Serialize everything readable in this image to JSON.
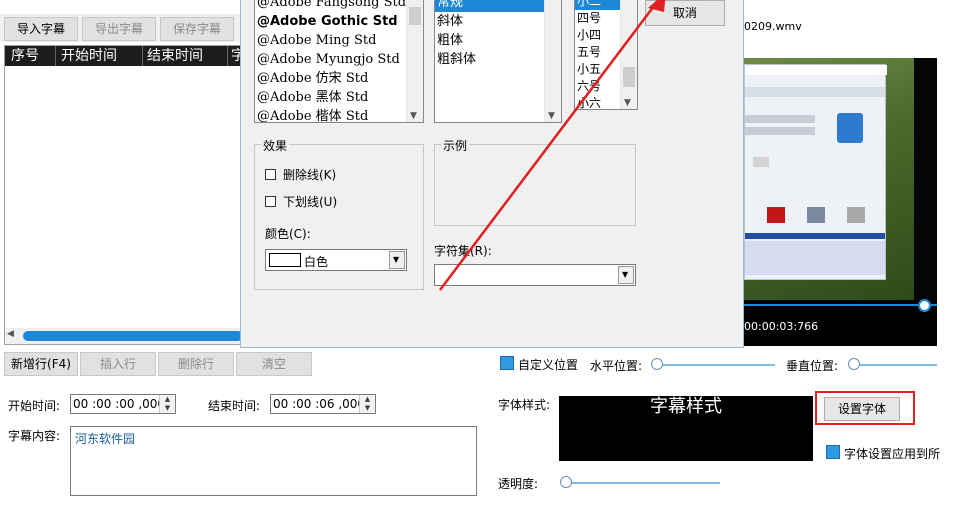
{
  "toolbar": {
    "import_label": "导入字幕",
    "export_label": "导出字幕",
    "save_label": "保存字幕"
  },
  "subtitle_table": {
    "columns": [
      "序号",
      "开始时间",
      "结束时间",
      "字"
    ]
  },
  "row_actions": {
    "add_label": "新增行(F4)",
    "insert_label": "插入行",
    "delete_label": "删除行",
    "clear_label": "清空"
  },
  "editor": {
    "start_label": "开始时间:",
    "start_value": "00 :00 :00 ,000",
    "end_label": "结束时间:",
    "end_value": "00 :00 :06 ,000",
    "content_label": "字幕内容:",
    "content_value": "河东软件园"
  },
  "video": {
    "filename": "0209.wmv",
    "time": "00:00:03:766",
    "progress": 0.97
  },
  "position": {
    "custom_label": "自定义位置",
    "horizontal_label": "水平位置:",
    "vertical_label": "垂直位置:"
  },
  "font_panel": {
    "style_label": "字体样式:",
    "preview_text": "字幕样式",
    "set_font_label": "设置字体",
    "apply_all_label": "字体设置应用到所",
    "opacity_label": "透明度:"
  },
  "font_dialog": {
    "cancel_label": "取消",
    "fonts": [
      "@Adobe Fangsong Std",
      "@Adobe Gothic Std",
      "@Adobe Ming Std",
      "@Adobe Myungjo Std",
      "@Adobe 仿宋 Std",
      "@Adobe 黑体 Std",
      "@Adobe 楷体 Std"
    ],
    "styles": [
      "常规",
      "斜体",
      "粗体",
      "粗斜体"
    ],
    "sizes": [
      "小二",
      "四号",
      "小四",
      "五号",
      "小五",
      "六号",
      "小六"
    ],
    "effects_title": "效果",
    "strikeout_label": "删除线(K)",
    "underline_label": "下划线(U)",
    "color_label": "颜色(C):",
    "color_value": "白色",
    "sample_title": "示例",
    "charset_label": "字符集(R):",
    "charset_value": ""
  },
  "colors": {
    "accent": "#2f9ae0",
    "highlight": "#e02020"
  }
}
